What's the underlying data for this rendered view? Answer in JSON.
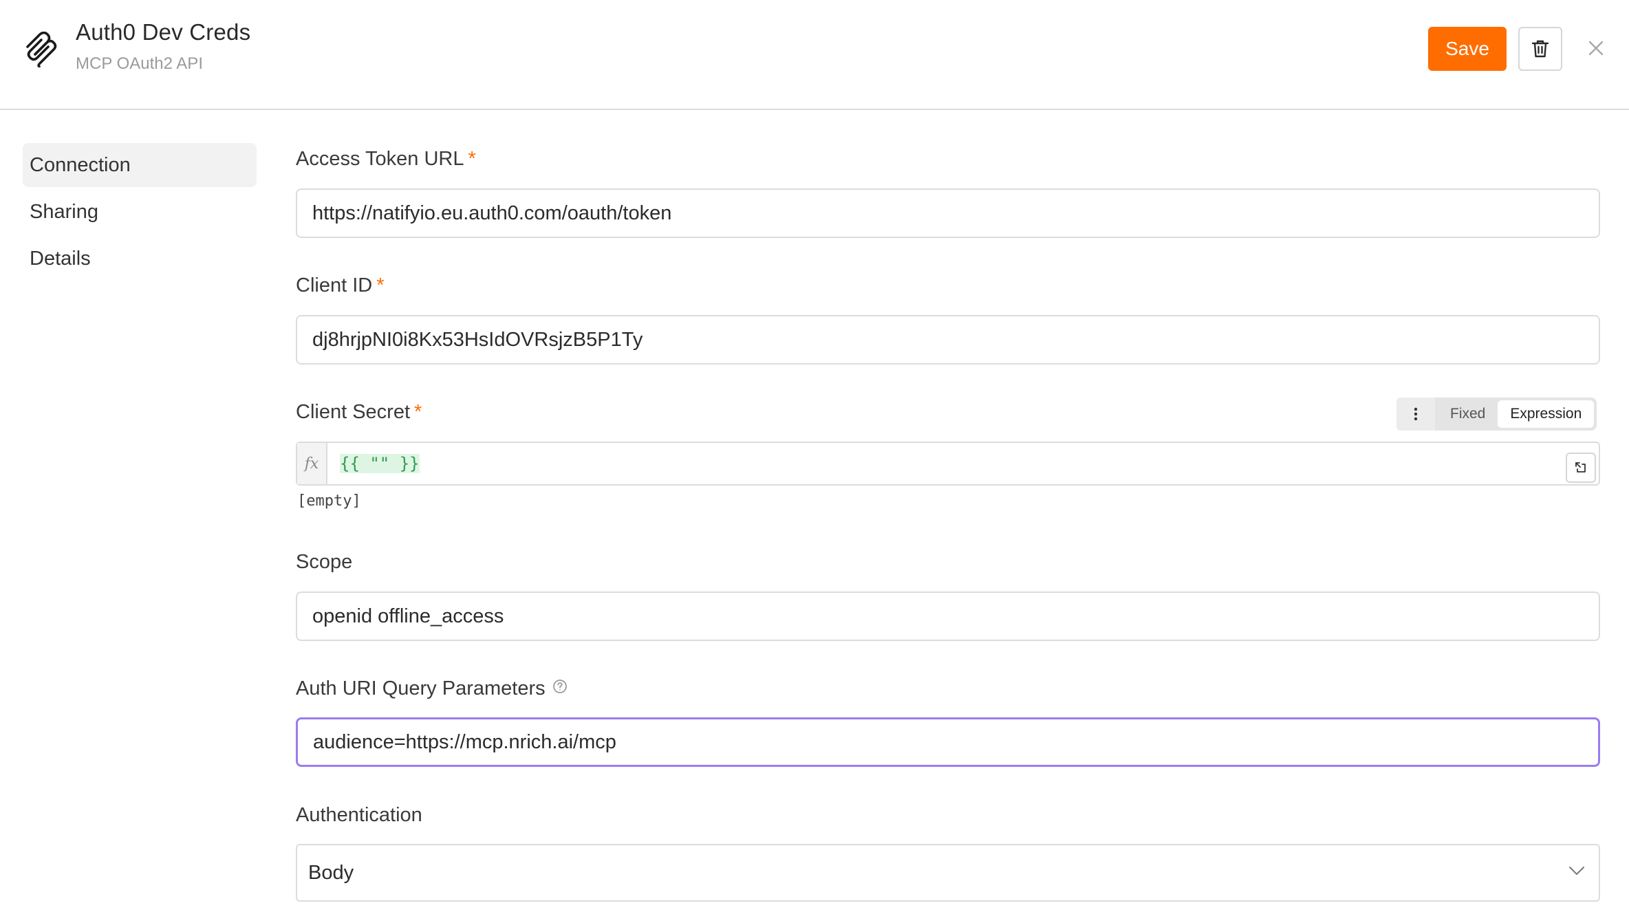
{
  "header": {
    "title": "Auth0 Dev Creds",
    "subtitle": "MCP OAuth2 API",
    "save_label": "Save",
    "logo_icon": "mcp-logo-icon",
    "accent_color": "#ff6d00"
  },
  "sidebar": {
    "items": [
      {
        "label": "Connection",
        "active": true
      },
      {
        "label": "Sharing",
        "active": false
      },
      {
        "label": "Details",
        "active": false
      }
    ]
  },
  "form": {
    "access_token_url": {
      "label": "Access Token URL",
      "required_mark": "*",
      "value": "https://natifyio.eu.auth0.com/oauth/token"
    },
    "client_id": {
      "label": "Client ID",
      "required_mark": "*",
      "value": "dj8hrjpNI0i8Kx53HsIdOVRsjzB5P1Ty"
    },
    "client_secret": {
      "label": "Client Secret",
      "required_mark": "*",
      "mode_options": [
        "Fixed",
        "Expression"
      ],
      "selected_mode": "Expression",
      "fx_label": "fx",
      "expression_open": "{{",
      "expression_literal": "\"\"",
      "expression_close": "}}",
      "result_preview": "[empty]"
    },
    "scope": {
      "label": "Scope",
      "value": "openid offline_access"
    },
    "auth_uri_query_parameters": {
      "label": "Auth URI Query Parameters",
      "value": "audience=https://mcp.nrich.ai/mcp",
      "focused": true
    },
    "authentication": {
      "label": "Authentication",
      "selected": "Body"
    }
  }
}
